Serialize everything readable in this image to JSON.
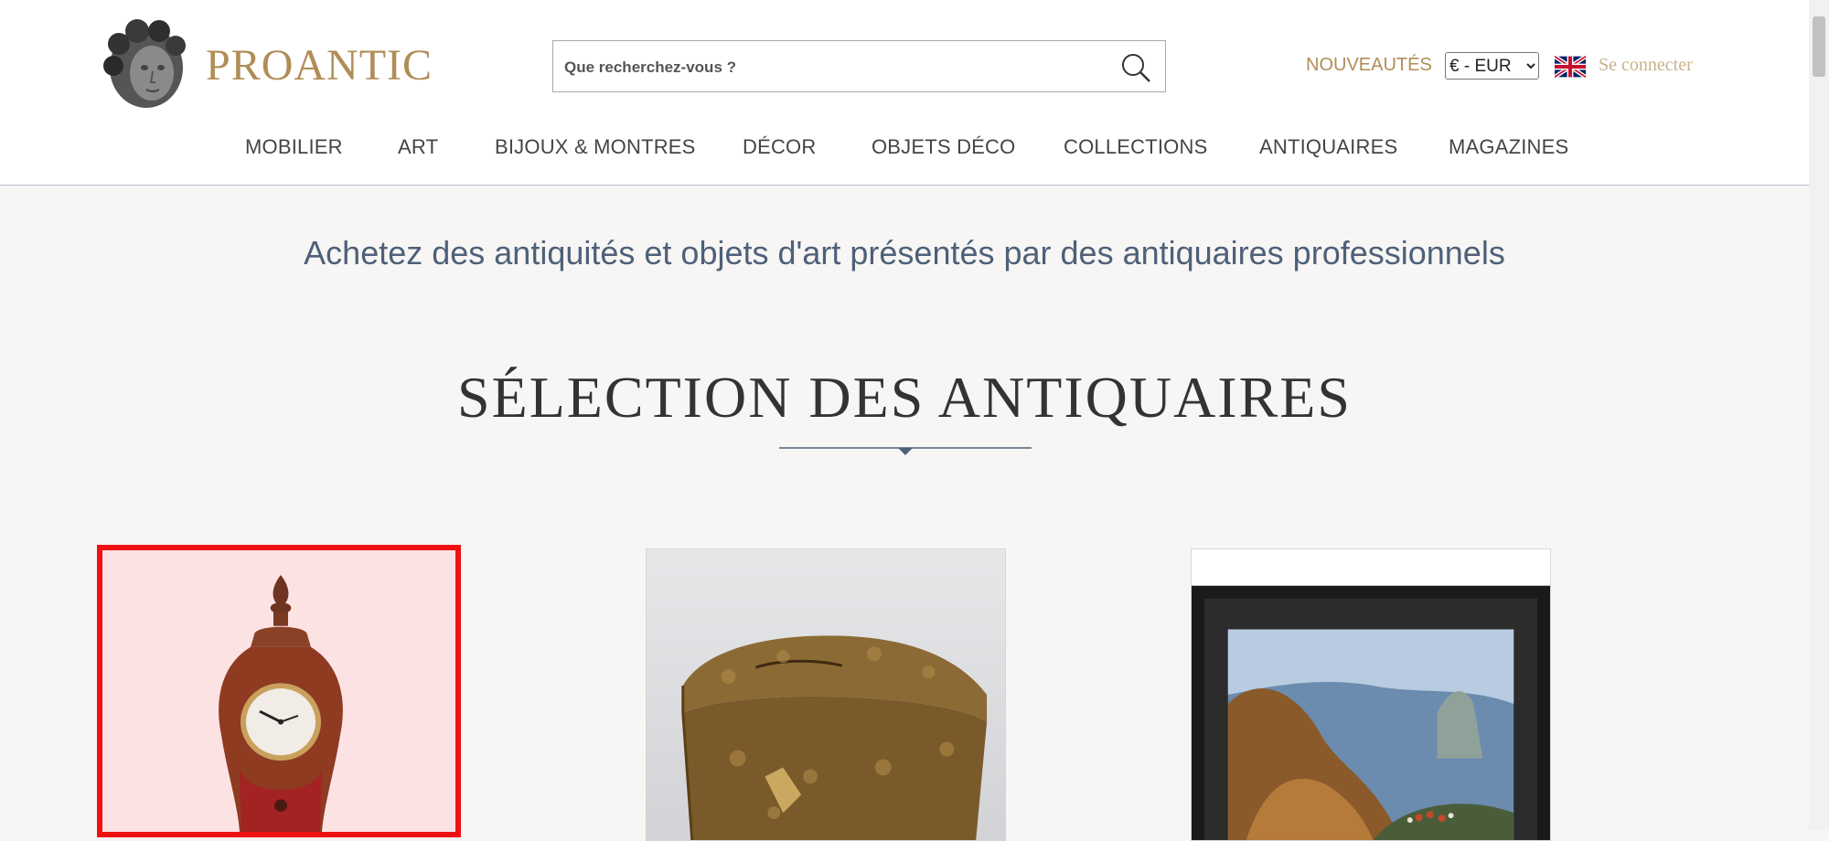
{
  "header": {
    "brand": "PROANTIC",
    "search_placeholder": "Que recherchez-vous ?",
    "nouveautes": "NOUVEAUTÉS",
    "currency": {
      "selected": "€ - EUR",
      "options": [
        "€ - EUR"
      ]
    },
    "login": "Se connecter",
    "language_flag": "uk-flag-icon"
  },
  "nav": {
    "items": [
      {
        "label": "MOBILIER"
      },
      {
        "label": "ART"
      },
      {
        "label": "BIJOUX & MONTRES"
      },
      {
        "label": "DÉCOR"
      },
      {
        "label": "OBJETS DÉCO"
      },
      {
        "label": "COLLECTIONS"
      },
      {
        "label": "ANTIQUAIRES"
      },
      {
        "label": "MAGAZINES"
      }
    ]
  },
  "main": {
    "tagline": "Achetez des antiquités et objets d'art présentés par des antiquaires professionnels",
    "section_title": "SÉLECTION DES ANTIQUAIRES",
    "cards": [
      {
        "image": "mantel-clock-image",
        "highlighted": true
      },
      {
        "image": "embossed-leather-box-image",
        "highlighted": false
      },
      {
        "image": "framed-landscape-painting-image",
        "highlighted": false
      }
    ]
  },
  "colors": {
    "brand_gold": "#b08d57",
    "accent_blue": "#4e6079",
    "highlight_red": "#ee1111",
    "background": "#f7f6f4"
  }
}
